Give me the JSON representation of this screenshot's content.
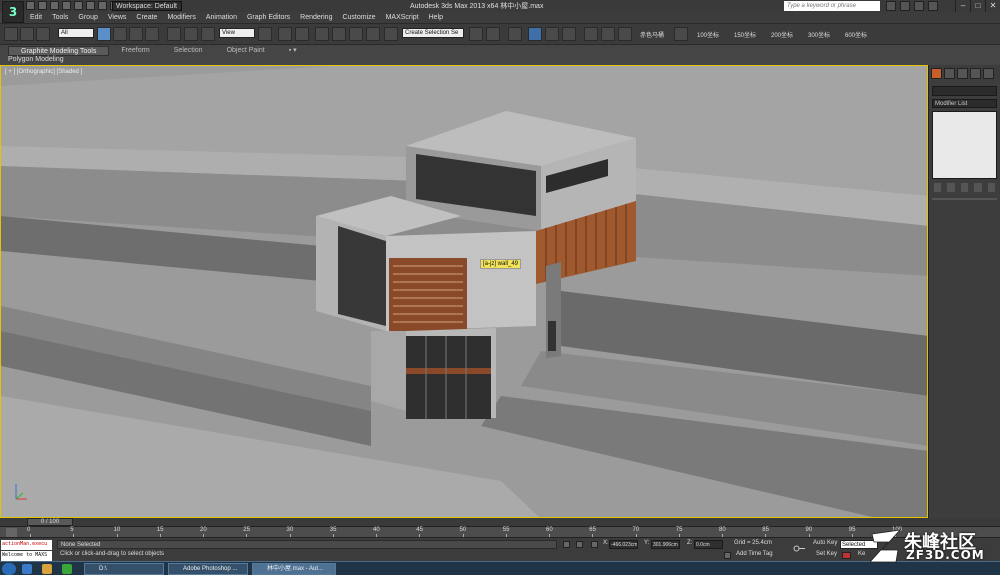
{
  "window": {
    "workspace_label": "Workspace: Default",
    "title": "Autodesk 3ds Max  2013 x64     林中小屋.max",
    "search_placeholder": "Type a keyword or phrase",
    "min": "–",
    "max": "□",
    "close": "✕"
  },
  "menu": [
    "Edit",
    "Tools",
    "Group",
    "Views",
    "Create",
    "Modifiers",
    "Animation",
    "Graph Editors",
    "Rendering",
    "Customize",
    "MAXScript",
    "Help"
  ],
  "toolbar": {
    "filter_value": "All",
    "refcoord_value": "View",
    "selection_set_placeholder": "Create Selection Se",
    "presets": [
      "赤色马桶",
      "100坐标",
      "150坐标",
      "200坐标",
      "300坐标",
      "600坐标"
    ]
  },
  "ribbon": {
    "tabs": [
      "Graphite Modeling Tools",
      "Freeform",
      "Selection",
      "Object Paint"
    ],
    "active_tab": 0,
    "panel_label": "Polygon Modeling"
  },
  "viewport": {
    "label": "[ + ] [Orthographic] [Shaded ]",
    "tooltip": "[a-jz] wall_49",
    "accent": "#e3c400"
  },
  "command_panel": {
    "modifier_list_label": "Modifier List",
    "tab_icons": [
      "create-icon",
      "modify-icon",
      "hierarchy-icon",
      "motion-icon",
      "display-icon",
      "utilities-icon"
    ]
  },
  "timeline": {
    "slider_label": "0 / 100",
    "ticks": [
      "0",
      "5",
      "10",
      "15",
      "20",
      "25",
      "30",
      "35",
      "40",
      "45",
      "50",
      "55",
      "60",
      "65",
      "70",
      "75",
      "80",
      "85",
      "90",
      "95",
      "100"
    ]
  },
  "status": {
    "maxscript_line1": "actionMan.execu",
    "maxscript_line2": "Welcome to MAXS",
    "selection": "None Selected",
    "prompt": "Click or click-and-drag to select objects",
    "x_label": "X:",
    "x_value": "-466.023cm",
    "y_label": "Y:",
    "y_value": "301.906cm",
    "z_label": "Z:",
    "z_value": "0.0cm",
    "grid": "Grid = 25.4cm",
    "add_time_tag": "Add Time Tag",
    "auto_key": "Auto Key",
    "set_key": "Set Key",
    "key_filter_value": "Selected",
    "key_filters_abbrev": "Ke"
  },
  "taskbar": {
    "tasks": [
      "D:\\",
      "Adobe Photoshop ...",
      "林中小屋.max - Aut..."
    ]
  },
  "watermark": {
    "main": "朱峰社区",
    "sub": "ZF3D.COM"
  }
}
